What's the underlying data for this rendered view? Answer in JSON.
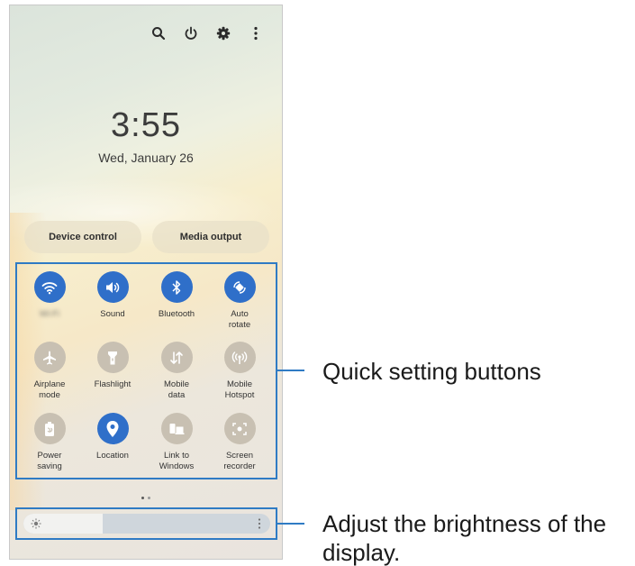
{
  "top_icons": [
    "search-icon",
    "power-icon",
    "gear-icon",
    "more-vertical-icon"
  ],
  "lock": {
    "time": "3:55",
    "date": "Wed, January 26"
  },
  "buttons": {
    "device_control": "Device control",
    "media_output": "Media output"
  },
  "quick_settings": [
    {
      "label": "Wi-Fi",
      "icon": "wifi-icon",
      "state": "on",
      "blurred": true
    },
    {
      "label": "Sound",
      "icon": "sound-icon",
      "state": "on"
    },
    {
      "label": "Bluetooth",
      "icon": "bluetooth-icon",
      "state": "on"
    },
    {
      "label": "Auto\nrotate",
      "icon": "auto-rotate-icon",
      "state": "on"
    },
    {
      "label": "Airplane\nmode",
      "icon": "airplane-icon",
      "state": "off"
    },
    {
      "label": "Flashlight",
      "icon": "flashlight-icon",
      "state": "off"
    },
    {
      "label": "Mobile\ndata",
      "icon": "mobile-data-icon",
      "state": "off"
    },
    {
      "label": "Mobile\nHotspot",
      "icon": "hotspot-icon",
      "state": "off"
    },
    {
      "label": "Power\nsaving",
      "icon": "power-saving-icon",
      "state": "off"
    },
    {
      "label": "Location",
      "icon": "location-icon",
      "state": "on"
    },
    {
      "label": "Link to\nWindows",
      "icon": "link-to-windows-icon",
      "state": "off"
    },
    {
      "label": "Screen\nrecorder",
      "icon": "screen-recorder-icon",
      "state": "off"
    }
  ],
  "brightness": {
    "level": 0.32
  },
  "callouts": {
    "quick_settings": "Quick setting buttons",
    "brightness_line1": "Adjust the brightness of the",
    "brightness_line2": "display."
  },
  "colors": {
    "accent": "#2f7bc4",
    "tile_on": "#2f6fc9",
    "tile_off": "#c8c0b2"
  }
}
